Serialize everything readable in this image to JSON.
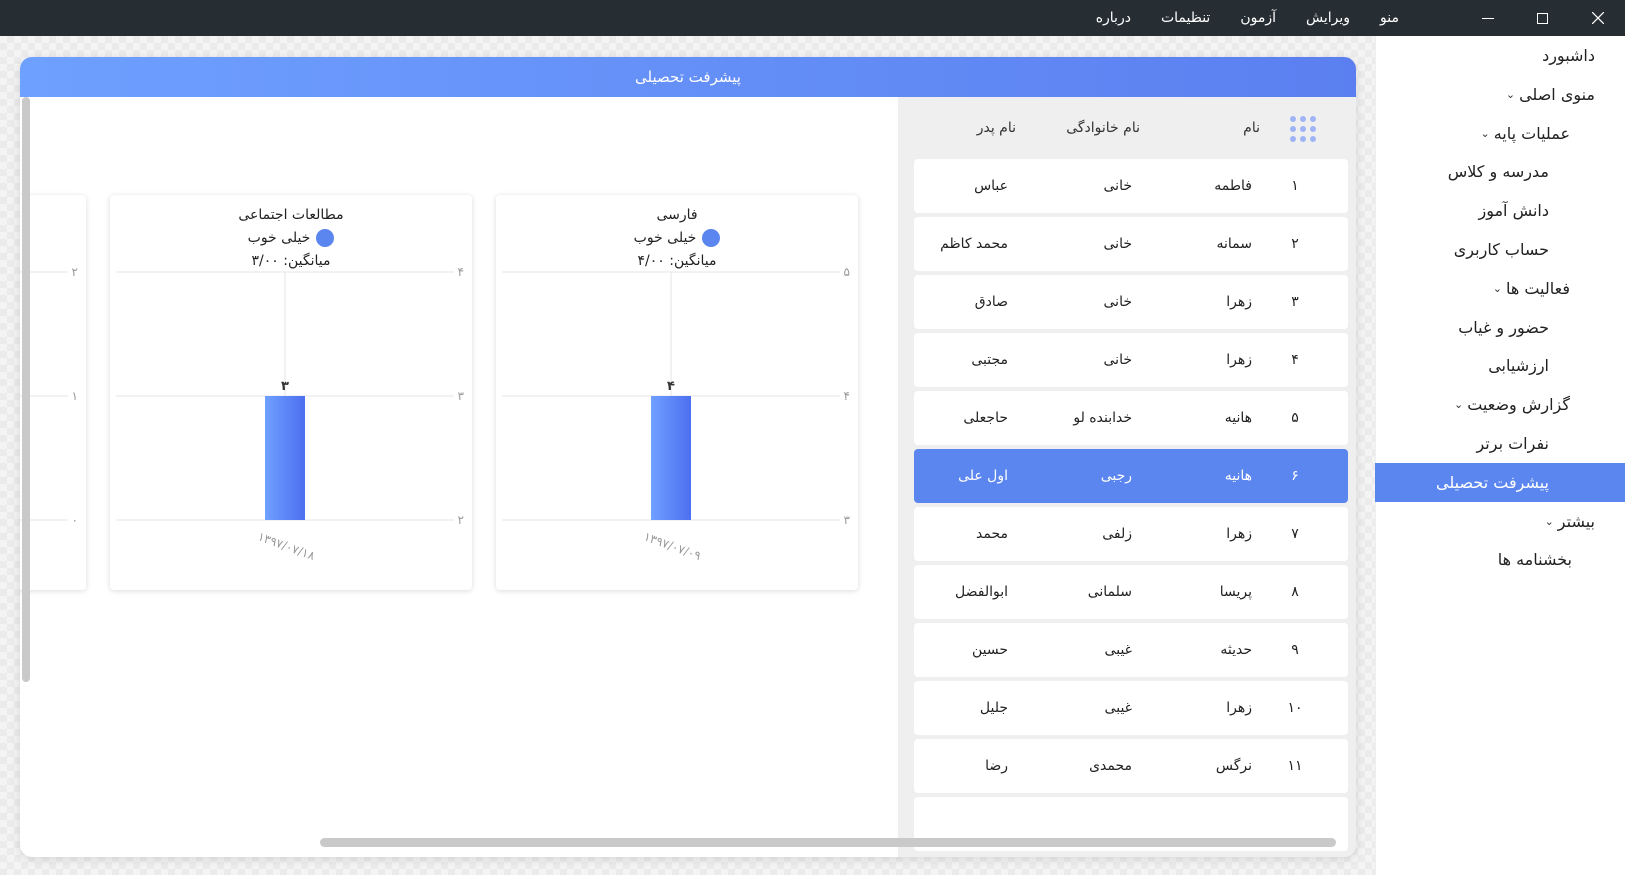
{
  "menubar": {
    "items": [
      "منو",
      "ویرایش",
      "آزمون",
      "تنظیمات",
      "درباره"
    ]
  },
  "sidebar": {
    "items": [
      {
        "label": "داشبورد",
        "chevron": false,
        "active": false,
        "indent": 30
      },
      {
        "label": "منوی اصلی",
        "chevron": true,
        "active": false,
        "indent": 30
      },
      {
        "label": "عملیات پایه",
        "chevron": true,
        "active": false,
        "indent": 55
      },
      {
        "label": "مدرسه و کلاس",
        "chevron": false,
        "active": false,
        "indent": 76
      },
      {
        "label": "دانش آموز",
        "chevron": false,
        "active": false,
        "indent": 76
      },
      {
        "label": "حساب کاربری",
        "chevron": false,
        "active": false,
        "indent": 76
      },
      {
        "label": "فعالیت ها",
        "chevron": true,
        "active": false,
        "indent": 55
      },
      {
        "label": "حضور و غیاب",
        "chevron": false,
        "active": false,
        "indent": 76
      },
      {
        "label": "ارزشیابی",
        "chevron": false,
        "active": false,
        "indent": 76
      },
      {
        "label": "گزارش وضعیت",
        "chevron": true,
        "active": false,
        "indent": 55
      },
      {
        "label": "نفرات برتر",
        "chevron": false,
        "active": false,
        "indent": 76
      },
      {
        "label": "پیشرفت تحصیلی",
        "chevron": false,
        "active": true,
        "indent": 76
      },
      {
        "label": "بیشتر",
        "chevron": true,
        "active": false,
        "indent": 30
      },
      {
        "label": "بخشنامه ها",
        "chevron": false,
        "active": false,
        "indent": 53
      }
    ]
  },
  "card": {
    "title": "پیشرفت تحصیلی"
  },
  "table": {
    "headers": {
      "name": "نام",
      "last_name": "نام خانوادگی",
      "father": "نام پدر"
    },
    "rows": [
      {
        "idx": "۱",
        "name": "فاطمه",
        "last_name": "خانی",
        "father": "عباس"
      },
      {
        "idx": "۲",
        "name": "سمانه",
        "last_name": "خانی",
        "father": "محمد کاظم"
      },
      {
        "idx": "۳",
        "name": "زهرا",
        "last_name": "خانی",
        "father": "صادق"
      },
      {
        "idx": "۴",
        "name": "زهرا",
        "last_name": "خانی",
        "father": "مجتبی"
      },
      {
        "idx": "۵",
        "name": "هانیه",
        "last_name": "خدابنده لو",
        "father": "حاجعلی"
      },
      {
        "idx": "۶",
        "name": "هانیه",
        "last_name": "رجبی",
        "father": "اول علی",
        "active": true
      },
      {
        "idx": "۷",
        "name": "زهرا",
        "last_name": "زلفی",
        "father": "محمد"
      },
      {
        "idx": "۸",
        "name": "پریسا",
        "last_name": "سلمانی",
        "father": "ابوالفضل"
      },
      {
        "idx": "۹",
        "name": "حدیثه",
        "last_name": "غیبی",
        "father": "حسین"
      },
      {
        "idx": "۱۰",
        "name": "زهرا",
        "last_name": "غیبی",
        "father": "جلیل"
      },
      {
        "idx": "۱۱",
        "name": "نرگس",
        "last_name": "محمدی",
        "father": "رضا"
      }
    ]
  },
  "colors": {
    "accent": "#5b86f0",
    "bar_light": "#6fa0ff",
    "bar_dark": "#4d6ff0"
  },
  "chart_data": [
    {
      "type": "bar",
      "title": "فارسی",
      "legend": "خیلی خوب",
      "average_text": "میانگین: ۴/۰۰",
      "categories": [
        "۱۳۹۷/۰۷/۰۹"
      ],
      "values": [
        4
      ],
      "value_labels": [
        "۴"
      ],
      "ylim": [
        3,
        5
      ],
      "yticks": [
        3,
        4,
        5
      ],
      "ytick_labels": [
        "۳",
        "۴",
        "۵"
      ],
      "grid": true
    },
    {
      "type": "bar",
      "title": "مطالعات اجتماعی",
      "legend": "خیلی خوب",
      "average_text": "میانگین: ۳/۰۰",
      "categories": [
        "۱۳۹۷/۰۷/۱۸"
      ],
      "values": [
        3
      ],
      "value_labels": [
        "۳"
      ],
      "ylim": [
        2,
        4
      ],
      "yticks": [
        2,
        3,
        4
      ],
      "ytick_labels": [
        "۲",
        "۳",
        "۴"
      ],
      "grid": true
    },
    {
      "type": "bar",
      "title": "",
      "categories": [],
      "values": [],
      "ylim": [
        0,
        2
      ],
      "yticks": [
        0,
        1,
        2
      ],
      "ytick_labels": [
        "۰",
        "۱",
        "۲"
      ],
      "grid": true
    }
  ]
}
